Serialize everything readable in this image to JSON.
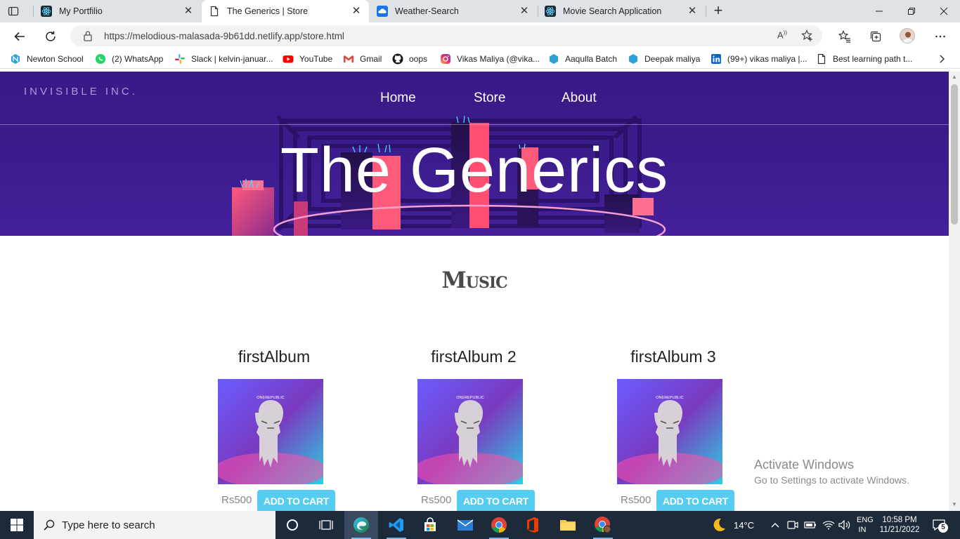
{
  "browser": {
    "tabs": [
      {
        "title": "My Portfilio",
        "active": false
      },
      {
        "title": "The Generics | Store",
        "active": true
      },
      {
        "title": "Weather-Search",
        "active": false
      },
      {
        "title": "Movie Search Application",
        "active": false
      }
    ],
    "url": "https://melodious-malasada-9b61dd.netlify.app/store.html",
    "favorites": [
      {
        "label": "Newton School",
        "icon": "newton-icon"
      },
      {
        "label": "(2) WhatsApp",
        "icon": "whatsapp-icon"
      },
      {
        "label": "Slack | kelvin-januar...",
        "icon": "slack-icon"
      },
      {
        "label": "YouTube",
        "icon": "youtube-icon"
      },
      {
        "label": "Gmail",
        "icon": "gmail-icon"
      },
      {
        "label": "oops",
        "icon": "github-icon"
      },
      {
        "label": "Vikas Maliya (@vika...",
        "icon": "instagram-icon"
      },
      {
        "label": "Aaqulla Batch",
        "icon": "newton-icon"
      },
      {
        "label": "Deepak maliya",
        "icon": "newton-icon"
      },
      {
        "label": "(99+) vikas maliya |...",
        "icon": "linkedin-icon"
      },
      {
        "label": "Best learning path t...",
        "icon": "page-icon"
      }
    ]
  },
  "site": {
    "brand": "INVISIBLE INC.",
    "nav": [
      "Home",
      "Store",
      "About"
    ],
    "hero_title": "The Generics",
    "section_title": "Music",
    "albums": [
      {
        "title": "firstAlbum",
        "price": "Rs500",
        "button": "ADD TO CART",
        "cover_text": "ONEREPUBLIC"
      },
      {
        "title": "firstAlbum 2",
        "price": "Rs500",
        "button": "ADD TO CART",
        "cover_text": "ONEREPUBLIC"
      },
      {
        "title": "firstAlbum 3",
        "price": "Rs500",
        "button": "ADD TO CART",
        "cover_text": "ONEREPUBLIC"
      }
    ]
  },
  "watermark": {
    "line1": "Activate Windows",
    "line2": "Go to Settings to activate Windows."
  },
  "taskbar": {
    "search_placeholder": "Type here to search",
    "weather": "14°C",
    "lang1": "ENG",
    "lang2": "IN",
    "time": "10:58 PM",
    "date": "11/21/2022",
    "notifications": "5"
  },
  "colors": {
    "hero_bg": "#3b1c8c",
    "button": "#56ccf2",
    "taskbar": "#1d2a3a"
  }
}
